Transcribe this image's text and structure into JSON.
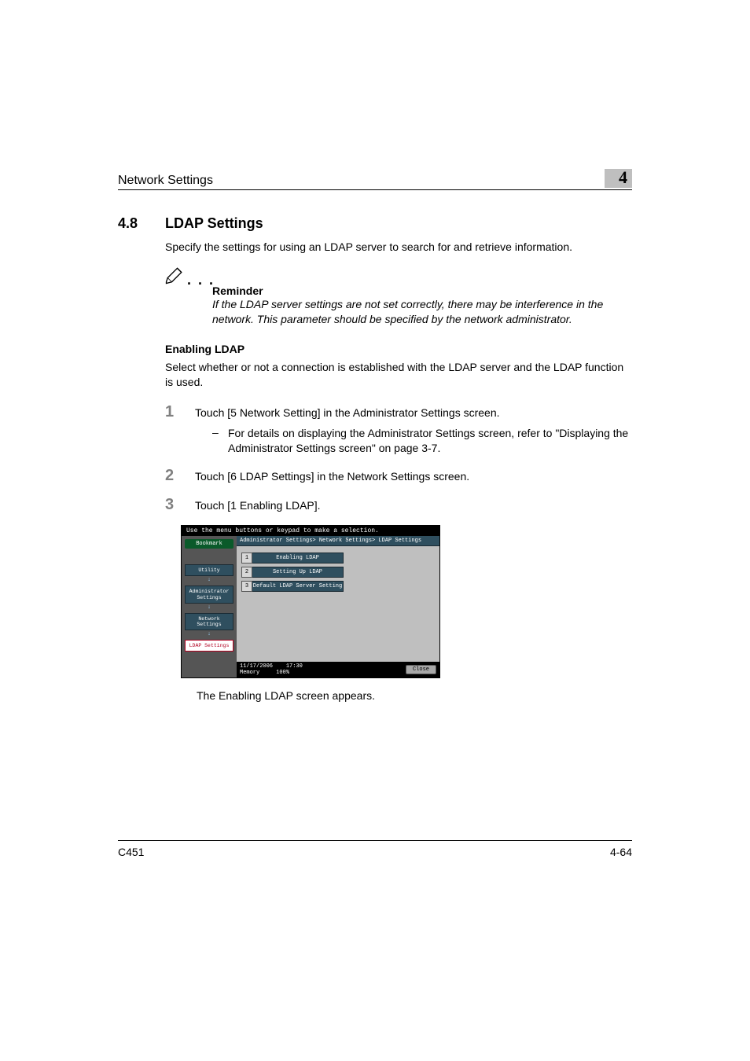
{
  "header": {
    "title": "Network Settings",
    "chapter": "4"
  },
  "section": {
    "number": "4.8",
    "title": "LDAP Settings"
  },
  "intro": "Specify the settings for using an LDAP server to search for and retrieve information.",
  "note": {
    "dots": ". . .",
    "heading": "Reminder",
    "body": "If the LDAP server settings are not set correctly, there may be interference in the network. This parameter should be specified by the network administrator."
  },
  "subhead": "Enabling LDAP",
  "subintro": "Select whether or not a connection is established with the LDAP server and the LDAP function is used.",
  "steps": [
    {
      "num": "1",
      "text": "Touch [5 Network Setting] in the Administrator Settings screen.",
      "sub": "For details on displaying the Administrator Settings screen, refer to \"Displaying the Administrator Settings screen\" on page 3-7."
    },
    {
      "num": "2",
      "text": "Touch [6 LDAP Settings] in the Network Settings screen."
    },
    {
      "num": "3",
      "text": "Touch [1 Enabling LDAP]."
    }
  ],
  "ui": {
    "topbar": "Use the menu buttons or keypad to make a selection.",
    "bookmark": "Bookmark",
    "breadcrumb": "Administrator Settings> Network Settings> LDAP Settings",
    "nav": {
      "utility": "Utility",
      "admin": "Administrator Settings",
      "network": "Network Settings",
      "current": "LDAP Settings"
    },
    "items": [
      {
        "n": "1",
        "label": "Enabling LDAP"
      },
      {
        "n": "2",
        "label": "Setting Up LDAP"
      },
      {
        "n": "3",
        "label": "Default LDAP Server Setting"
      }
    ],
    "footer": {
      "date": "11/17/2006",
      "time": "17:30",
      "memory_label": "Memory",
      "memory_value": "100%",
      "close": "Close"
    }
  },
  "postnote": "The Enabling LDAP screen appears.",
  "footer": {
    "model": "C451",
    "page": "4-64"
  }
}
